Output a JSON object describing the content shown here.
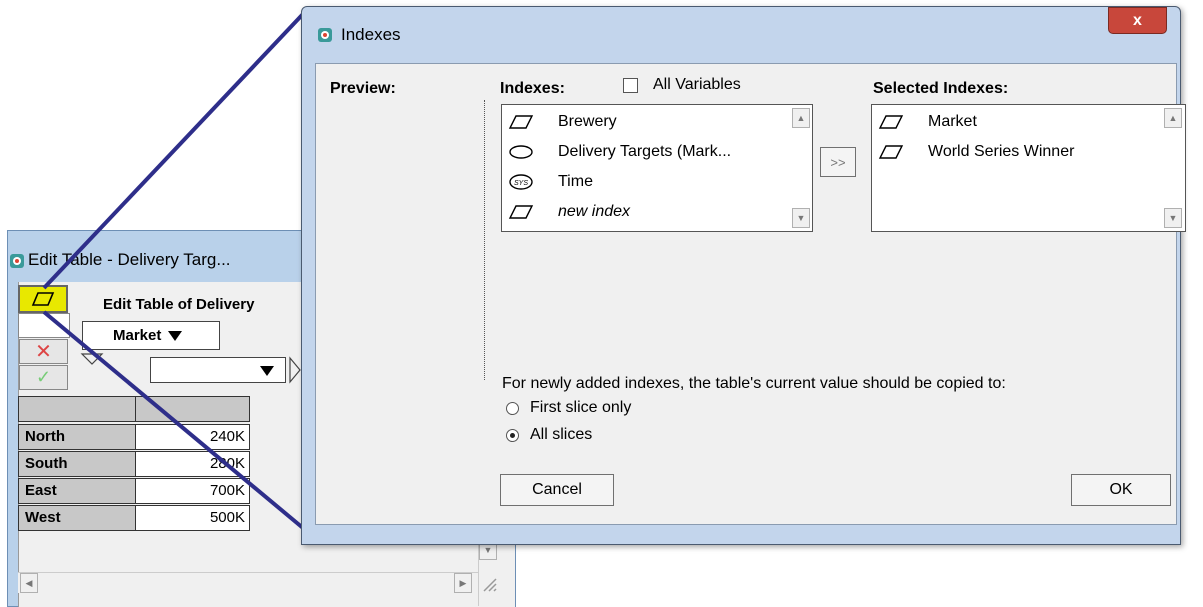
{
  "back_window": {
    "title": "Edit Table - Delivery Targ...",
    "table_title": "Edit Table of Delivery",
    "index_dropdown": "Market",
    "rows": [
      {
        "label": "North",
        "value": "240K"
      },
      {
        "label": "South",
        "value": "280K"
      },
      {
        "label": "East",
        "value": "700K"
      },
      {
        "label": "West",
        "value": "500K"
      }
    ]
  },
  "dialog": {
    "title": "Indexes",
    "close_label": "x",
    "preview_label": "Preview:",
    "indexes_label": "Indexes:",
    "all_variables_label": "All Variables",
    "selected_label": "Selected Indexes:",
    "indexes_list": [
      {
        "label": "Brewery",
        "icon": "index-icon",
        "italic": false
      },
      {
        "label": "Delivery Targets (Mark...",
        "icon": "variable-oval-icon",
        "italic": false
      },
      {
        "label": "Time",
        "icon": "system-index-icon",
        "italic": false
      },
      {
        "label": "new index",
        "icon": "index-icon",
        "italic": true
      }
    ],
    "selected_list": [
      {
        "label": "Market",
        "icon": "index-icon"
      },
      {
        "label": "World Series Winner",
        "icon": "index-icon"
      }
    ],
    "move_button": ">>",
    "copy_prompt": "For newly added indexes, the table's current value should be copied to:",
    "radio_options": [
      {
        "label": "First slice only",
        "selected": false
      },
      {
        "label": "All slices",
        "selected": true
      }
    ],
    "cancel_label": "Cancel",
    "ok_label": "OK"
  },
  "colors": {
    "highlight_button": "#e8e800",
    "callout_line": "#2e2e8a",
    "close_button": "#c8473b"
  }
}
